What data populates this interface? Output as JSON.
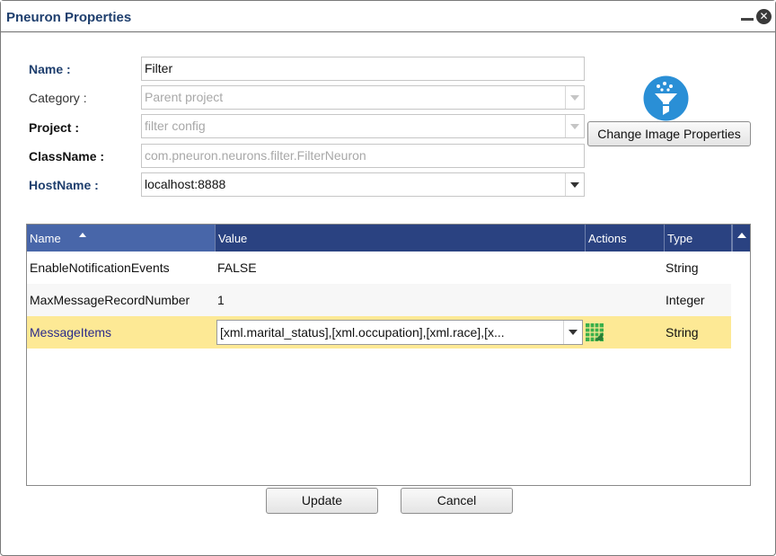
{
  "dialog": {
    "title": "Pneuron Properties"
  },
  "form": {
    "name": {
      "label": "Name :",
      "value": "Filter"
    },
    "category": {
      "label": "Category :",
      "value": "Parent project"
    },
    "project": {
      "label": "Project :",
      "value": "filter config"
    },
    "classname": {
      "label": "ClassName :",
      "value": "com.pneuron.neurons.filter.FilterNeuron"
    },
    "hostname": {
      "label": "HostName :",
      "value": "localhost:8888"
    }
  },
  "image": {
    "icon": "funnel-icon",
    "change_button": "Change Image Properties"
  },
  "grid": {
    "columns": [
      "Name",
      "Value",
      "Actions",
      "Type"
    ],
    "sorted_column": "Name",
    "sort_direction": "ascending",
    "rows": [
      {
        "name": "EnableNotificationEvents",
        "value": "FALSE",
        "type": "String"
      },
      {
        "name": "MaxMessageRecordNumber",
        "value": "1",
        "type": "Integer"
      },
      {
        "name": "MessageItems",
        "value": "[xml.marital_status],[xml.occupation],[xml.race],[x...",
        "type": "String",
        "action_icon": "grid-edit-icon"
      }
    ]
  },
  "buttons": {
    "update": "Update",
    "cancel": "Cancel"
  },
  "colors": {
    "header_bg": "#2a4281",
    "selected_row": "#fde995",
    "title_text": "#1f3f6e",
    "icon_circle": "#2a8fd6",
    "grid_icon": "#3bb04a"
  }
}
